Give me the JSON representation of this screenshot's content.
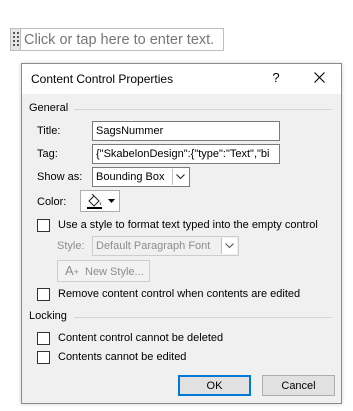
{
  "document": {
    "placeholder_text": "Click or tap here to enter text."
  },
  "dialog": {
    "title": "Content Control Properties",
    "help_label": "?",
    "general": {
      "heading": "General",
      "title_label": "Title:",
      "title_value": "SagsNummer",
      "tag_label": "Tag:",
      "tag_value": "{\"SkabelonDesign\":{\"type\":\"Text\",\"bi",
      "show_as_label": "Show as:",
      "show_as_value": "Bounding Box",
      "color_label": "Color:",
      "use_style_label": "Use a style to format text typed into the empty control",
      "use_style_checked": false,
      "style_label": "Style:",
      "style_value": "Default Paragraph Font",
      "new_style_label": "New Style...",
      "remove_label": "Remove content control when contents are edited",
      "remove_checked": false
    },
    "locking": {
      "heading": "Locking",
      "cannot_delete_label": "Content control cannot be deleted",
      "cannot_delete_checked": false,
      "cannot_edit_label": "Contents cannot be edited",
      "cannot_edit_checked": false
    },
    "ok_label": "OK",
    "cancel_label": "Cancel"
  },
  "colors": {
    "default_button_border": "#0078d7",
    "dialog_background": "#f0f0f0"
  },
  "icons": {
    "handle": "drag-handle-icon",
    "close": "close-icon",
    "color": "paint-bucket-icon",
    "dropdown": "chevron-down-icon",
    "new_style": "new-style-icon"
  }
}
